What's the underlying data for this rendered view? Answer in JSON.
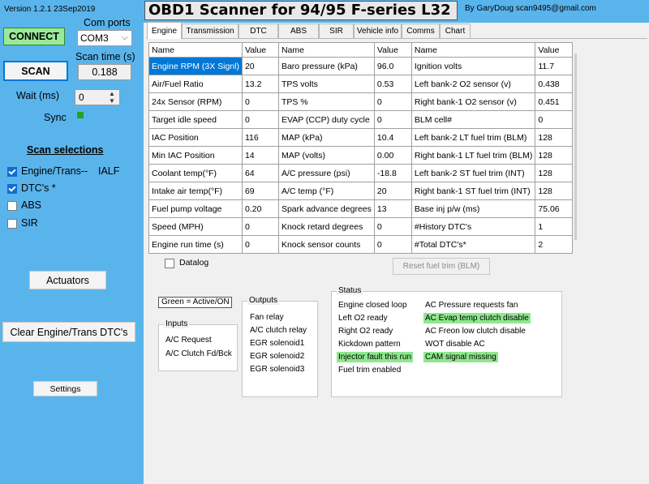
{
  "app": {
    "version": "Version 1.2.1 23Sep2019",
    "title": "OBD1 Scanner for 94/95 F-series L32",
    "author": "By GaryDoug scan9495@gmail.com",
    "colors": {
      "panel_blue": "#5ab4ec",
      "connect_green": "#9ae99a",
      "selected_blue": "#0078d7",
      "active_green": "#8ee88e",
      "sync_led": "#1fa51f"
    }
  },
  "left": {
    "connect_label": "CONNECT",
    "com_ports_label": "Com ports",
    "com_port_value": "COM3",
    "scan_label": "SCAN",
    "scan_time_label": "Scan time (s)",
    "scan_time_value": "0.188",
    "wait_label": "Wait (ms)",
    "wait_value": "0",
    "sync_label": "Sync",
    "scan_selections_title": "Scan selections",
    "selections": [
      {
        "label": "Engine/Trans--",
        "checked": true
      },
      {
        "label": "DTC's *",
        "checked": true
      },
      {
        "label": "ABS",
        "checked": false
      },
      {
        "label": "SIR",
        "checked": false
      }
    ],
    "aldl_tag": "IALF",
    "actuators_label": "Actuators",
    "clear_dtc_label": "Clear Engine/Trans DTC's",
    "settings_label": "Settings"
  },
  "tabs": [
    "Engine",
    "Transmission",
    "DTC",
    "ABS",
    "SIR",
    "Vehicle info",
    "Comms",
    "Chart"
  ],
  "active_tab": "Engine",
  "grid": {
    "headers": [
      "Name",
      "Value",
      "Name",
      "Value",
      "Name",
      "Value"
    ],
    "rows": [
      [
        "Engine RPM (3X Signl)",
        "20",
        "Baro pressure (kPa)",
        "96.0",
        "Ignition volts",
        "11.7"
      ],
      [
        "Air/Fuel Ratio",
        "13.2",
        "TPS volts",
        "0.53",
        "Left bank-2 O2 sensor (v)",
        "0.438"
      ],
      [
        "24x Sensor (RPM)",
        "0",
        "TPS %",
        "0",
        "Right bank-1 O2 sensor (v)",
        "0.451"
      ],
      [
        "Target idle speed",
        "0",
        "EVAP (CCP) duty cycle",
        "0",
        "BLM cell#",
        "0"
      ],
      [
        "IAC Position",
        "116",
        "MAP (kPa)",
        "10.4",
        "Left bank-2 LT fuel trim (BLM)",
        "128"
      ],
      [
        "Min IAC Position",
        "14",
        "MAP (volts)",
        "0.00",
        "Right bank-1 LT fuel trim (BLM)",
        "128"
      ],
      [
        "Coolant temp(°F)",
        "64",
        "A/C pressure (psi)",
        "-18.8",
        "Left bank-2 ST fuel trim (INT)",
        "128"
      ],
      [
        "Intake air temp(°F)",
        "69",
        "A/C temp (°F)",
        "20",
        "Right bank-1 ST fuel trim (INT)",
        "128"
      ],
      [
        "Fuel pump voltage",
        "0.20",
        "Spark advance degrees",
        "13",
        "Base inj p/w (ms)",
        "75.06"
      ],
      [
        "Speed (MPH)",
        "0",
        "Knock retard degrees",
        "0",
        "#History DTC's",
        "1"
      ],
      [
        "Engine run time (s)",
        "0",
        "Knock sensor counts",
        "0",
        "#Total DTC's*",
        "2"
      ]
    ]
  },
  "datalog_label": "Datalog",
  "reset_fuel_trim_label": "Reset fuel trim (BLM)",
  "legend_label": "Green = Active/ON",
  "inputs": {
    "title": "Inputs",
    "items": [
      "A/C Request",
      "A/C Clutch Fd/Bck"
    ]
  },
  "outputs": {
    "title": "Outputs",
    "items": [
      "Fan relay",
      "A/C clutch relay",
      "EGR solenoid1",
      "EGR solenoid2",
      "EGR solenoid3"
    ]
  },
  "status": {
    "title": "Status",
    "col1": [
      {
        "label": "Engine closed loop",
        "active": false
      },
      {
        "label": "Left O2 ready",
        "active": false
      },
      {
        "label": "Right O2 ready",
        "active": false
      },
      {
        "label": "Kickdown pattern",
        "active": false
      },
      {
        "label": "Injector fault this run",
        "active": true
      },
      {
        "label": "Fuel trim enabled",
        "active": false
      }
    ],
    "col2": [
      {
        "label": "AC Pressure requests fan",
        "active": false
      },
      {
        "label": "AC Evap temp clutch disable",
        "active": true
      },
      {
        "label": "AC Freon low clutch disable",
        "active": false
      },
      {
        "label": "WOT disable AC",
        "active": false
      },
      {
        "label": "CAM signal missing",
        "active": true
      }
    ]
  }
}
